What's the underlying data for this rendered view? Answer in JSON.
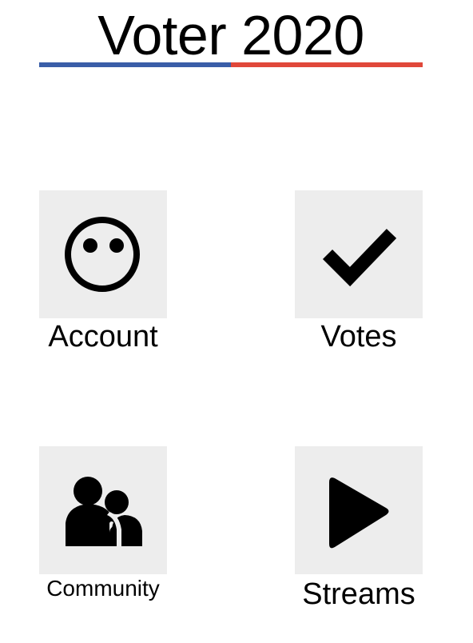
{
  "app": {
    "title": "Voter 2020"
  },
  "theme": {
    "accent_blue": "#3a5ea8",
    "accent_red": "#e0483a",
    "tile_background": "#ededed",
    "icon_color": "#000000"
  },
  "menu": {
    "items": [
      {
        "label": "Account",
        "icon": "smiley-face-icon"
      },
      {
        "label": "Votes",
        "icon": "checkmark-icon"
      },
      {
        "label": "Community",
        "icon": "people-icon"
      },
      {
        "label": "Streams",
        "icon": "play-icon"
      }
    ]
  }
}
